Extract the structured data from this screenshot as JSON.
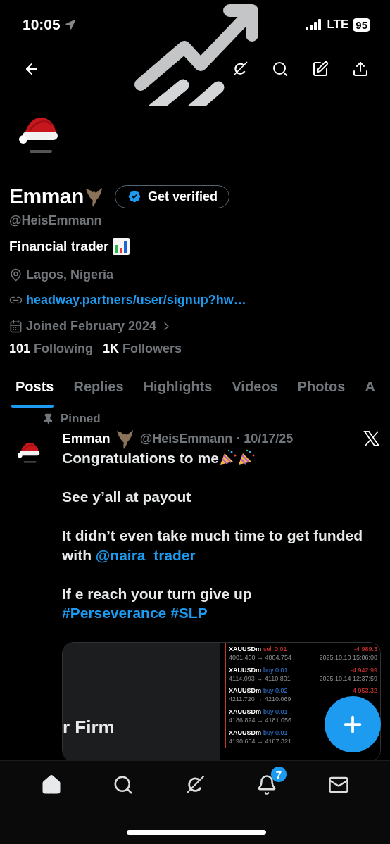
{
  "status_bar": {
    "time": "10:05",
    "network": "LTE",
    "battery": "95"
  },
  "profile": {
    "name": "Emman",
    "verify_button": "Get verified",
    "handle": "@HeisEmmann",
    "bio": "Financial trader",
    "location": "Lagos, Nigeria",
    "website": "headway.partners/user/signup?hw…",
    "joined": "Joined February 2024",
    "stats": [
      {
        "count": "101",
        "label": "Following"
      },
      {
        "count": "1K",
        "label": "Followers"
      }
    ]
  },
  "tabs": [
    {
      "label": "Posts",
      "selected": true
    },
    {
      "label": "Replies",
      "selected": false
    },
    {
      "label": "Highlights",
      "selected": false
    },
    {
      "label": "Videos",
      "selected": false
    },
    {
      "label": "Photos",
      "selected": false
    },
    {
      "label": "A",
      "selected": false
    }
  ],
  "pinned_post": {
    "pinned_label": "Pinned",
    "author": "Emman",
    "meta": "@HeisEmmann · 10/17/25",
    "paragraphs": [
      [
        {
          "kind": "text",
          "text": "Congratulations to me"
        },
        {
          "kind": "party"
        },
        {
          "kind": "party"
        }
      ],
      [
        {
          "kind": "text",
          "text": "See y’all at payout"
        }
      ],
      [
        {
          "kind": "text",
          "text": "It didn’t even take much time to get funded with "
        },
        {
          "kind": "mention",
          "text": "@naira_trader"
        }
      ],
      [
        {
          "kind": "text",
          "text": "If e reach your turn give up "
        },
        {
          "kind": "hashtag",
          "text": "#Perseverance"
        },
        {
          "kind": "hashtag",
          "text": "#SLP"
        }
      ]
    ],
    "media": {
      "card_text": "r Firm",
      "trades": [
        {
          "symbol": "XAUUSDm",
          "kind": "sell",
          "order": "sell 0.01",
          "prices": "4001.400 → 4004.754",
          "profit": "-4 989.3",
          "time": "2025.10.10 15:06:08"
        },
        {
          "symbol": "XAUUSDm",
          "kind": "buy",
          "order": "buy 0.01",
          "prices": "4114.093 → 4110.801",
          "profit": "-4 942.99",
          "time": "2025.10.14 12:37:59"
        },
        {
          "symbol": "XAUUSDm",
          "kind": "buy",
          "order": "buy 0.02",
          "prices": "4211.720 → 4210.069",
          "profit": "-4 953.32"
        },
        {
          "symbol": "XAUUSDm",
          "kind": "buy",
          "order": "buy 0.01",
          "prices": "4186.824 → 4181.056"
        },
        {
          "symbol": "XAUUSDm",
          "kind": "buy",
          "order": "buy 0.01",
          "prices": "4190.654 → 4187.321"
        }
      ]
    }
  },
  "nav": [
    {
      "kind": "home",
      "selected": true
    },
    {
      "kind": "search",
      "selected": false
    },
    {
      "kind": "grok",
      "selected": false
    },
    {
      "kind": "notifications",
      "selected": false,
      "badge": "7"
    },
    {
      "kind": "messages",
      "selected": false
    }
  ]
}
